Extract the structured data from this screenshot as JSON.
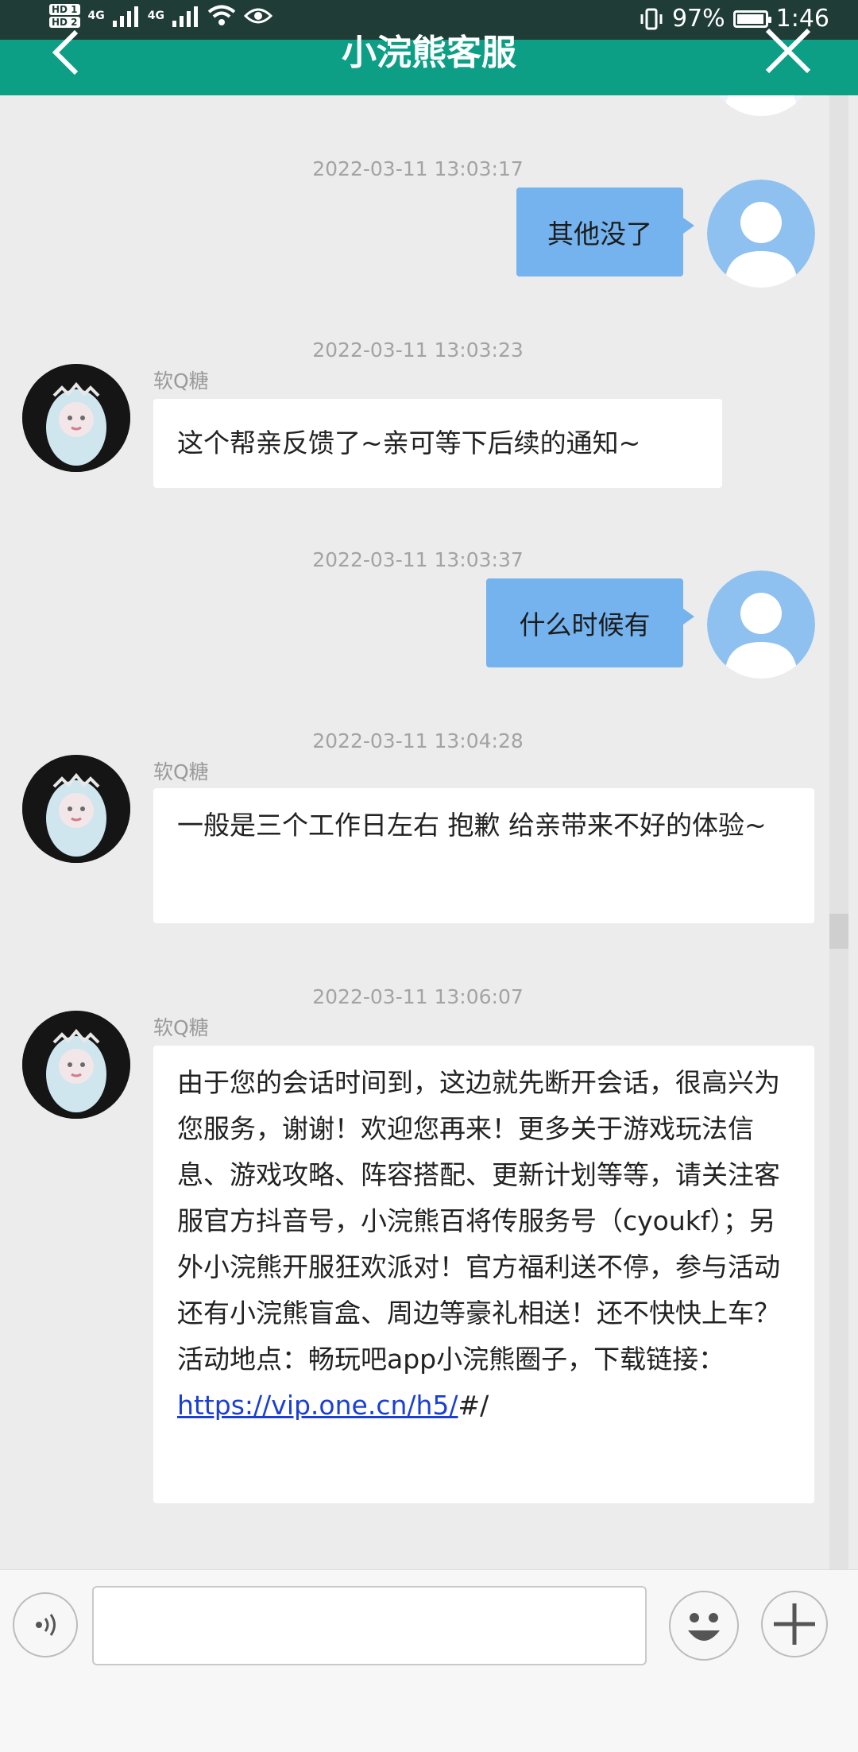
{
  "status_bar": {
    "sim1": "HD 1",
    "sim2": "HD 2",
    "net1": "4G",
    "net2": "4G",
    "battery": "97%",
    "battery_level": 0.97,
    "time": "1:46"
  },
  "header": {
    "title": "小浣熊客服",
    "back_icon": "chevron-left-icon",
    "close_icon": "close-icon",
    "color": "#0d9e86"
  },
  "messages": [
    {
      "timestamp": "2022-03-11 13:03:17",
      "from": "user",
      "text": "其他没了"
    },
    {
      "timestamp": "2022-03-11 13:03:23",
      "from": "agent",
      "sender": "软Q糖",
      "text": "这个帮亲反馈了~亲可等下后续的通知~"
    },
    {
      "timestamp": "2022-03-11 13:03:37",
      "from": "user",
      "text": "什么时候有"
    },
    {
      "timestamp": "2022-03-11 13:04:28",
      "from": "agent",
      "sender": "软Q糖",
      "text": "一般是三个工作日左右 抱歉 给亲带来不好的体验~"
    },
    {
      "timestamp": "2022-03-11 13:06:07",
      "from": "agent",
      "sender": "软Q糖",
      "text": "由于您的会话时间到，这边就先断开会话，很高兴为您服务，谢谢！欢迎您再来！更多关于游戏玩法信息、游戏攻略、阵容搭配、更新计划等等，请关注客服官方抖音号，小浣熊百将传服务号（cyoukf）；另外小浣熊开服狂欢派对！官方福利送不停，参与活动还有小浣熊盲盒、周边等豪礼相送！还不快快上车？活动地点：畅玩吧app小浣熊圈子，下载链接：",
      "link": "https://vip.one.cn/h5/",
      "suffix": "#/"
    }
  ],
  "input_bar": {
    "voice_icon": "voice-icon",
    "emoji_icon": "emoji-icon",
    "plus_icon": "plus-icon",
    "text_value": ""
  },
  "colors": {
    "outgoing_bubble": "#74b3ee",
    "incoming_bubble": "#ffffff",
    "link": "#1a3fd6"
  }
}
